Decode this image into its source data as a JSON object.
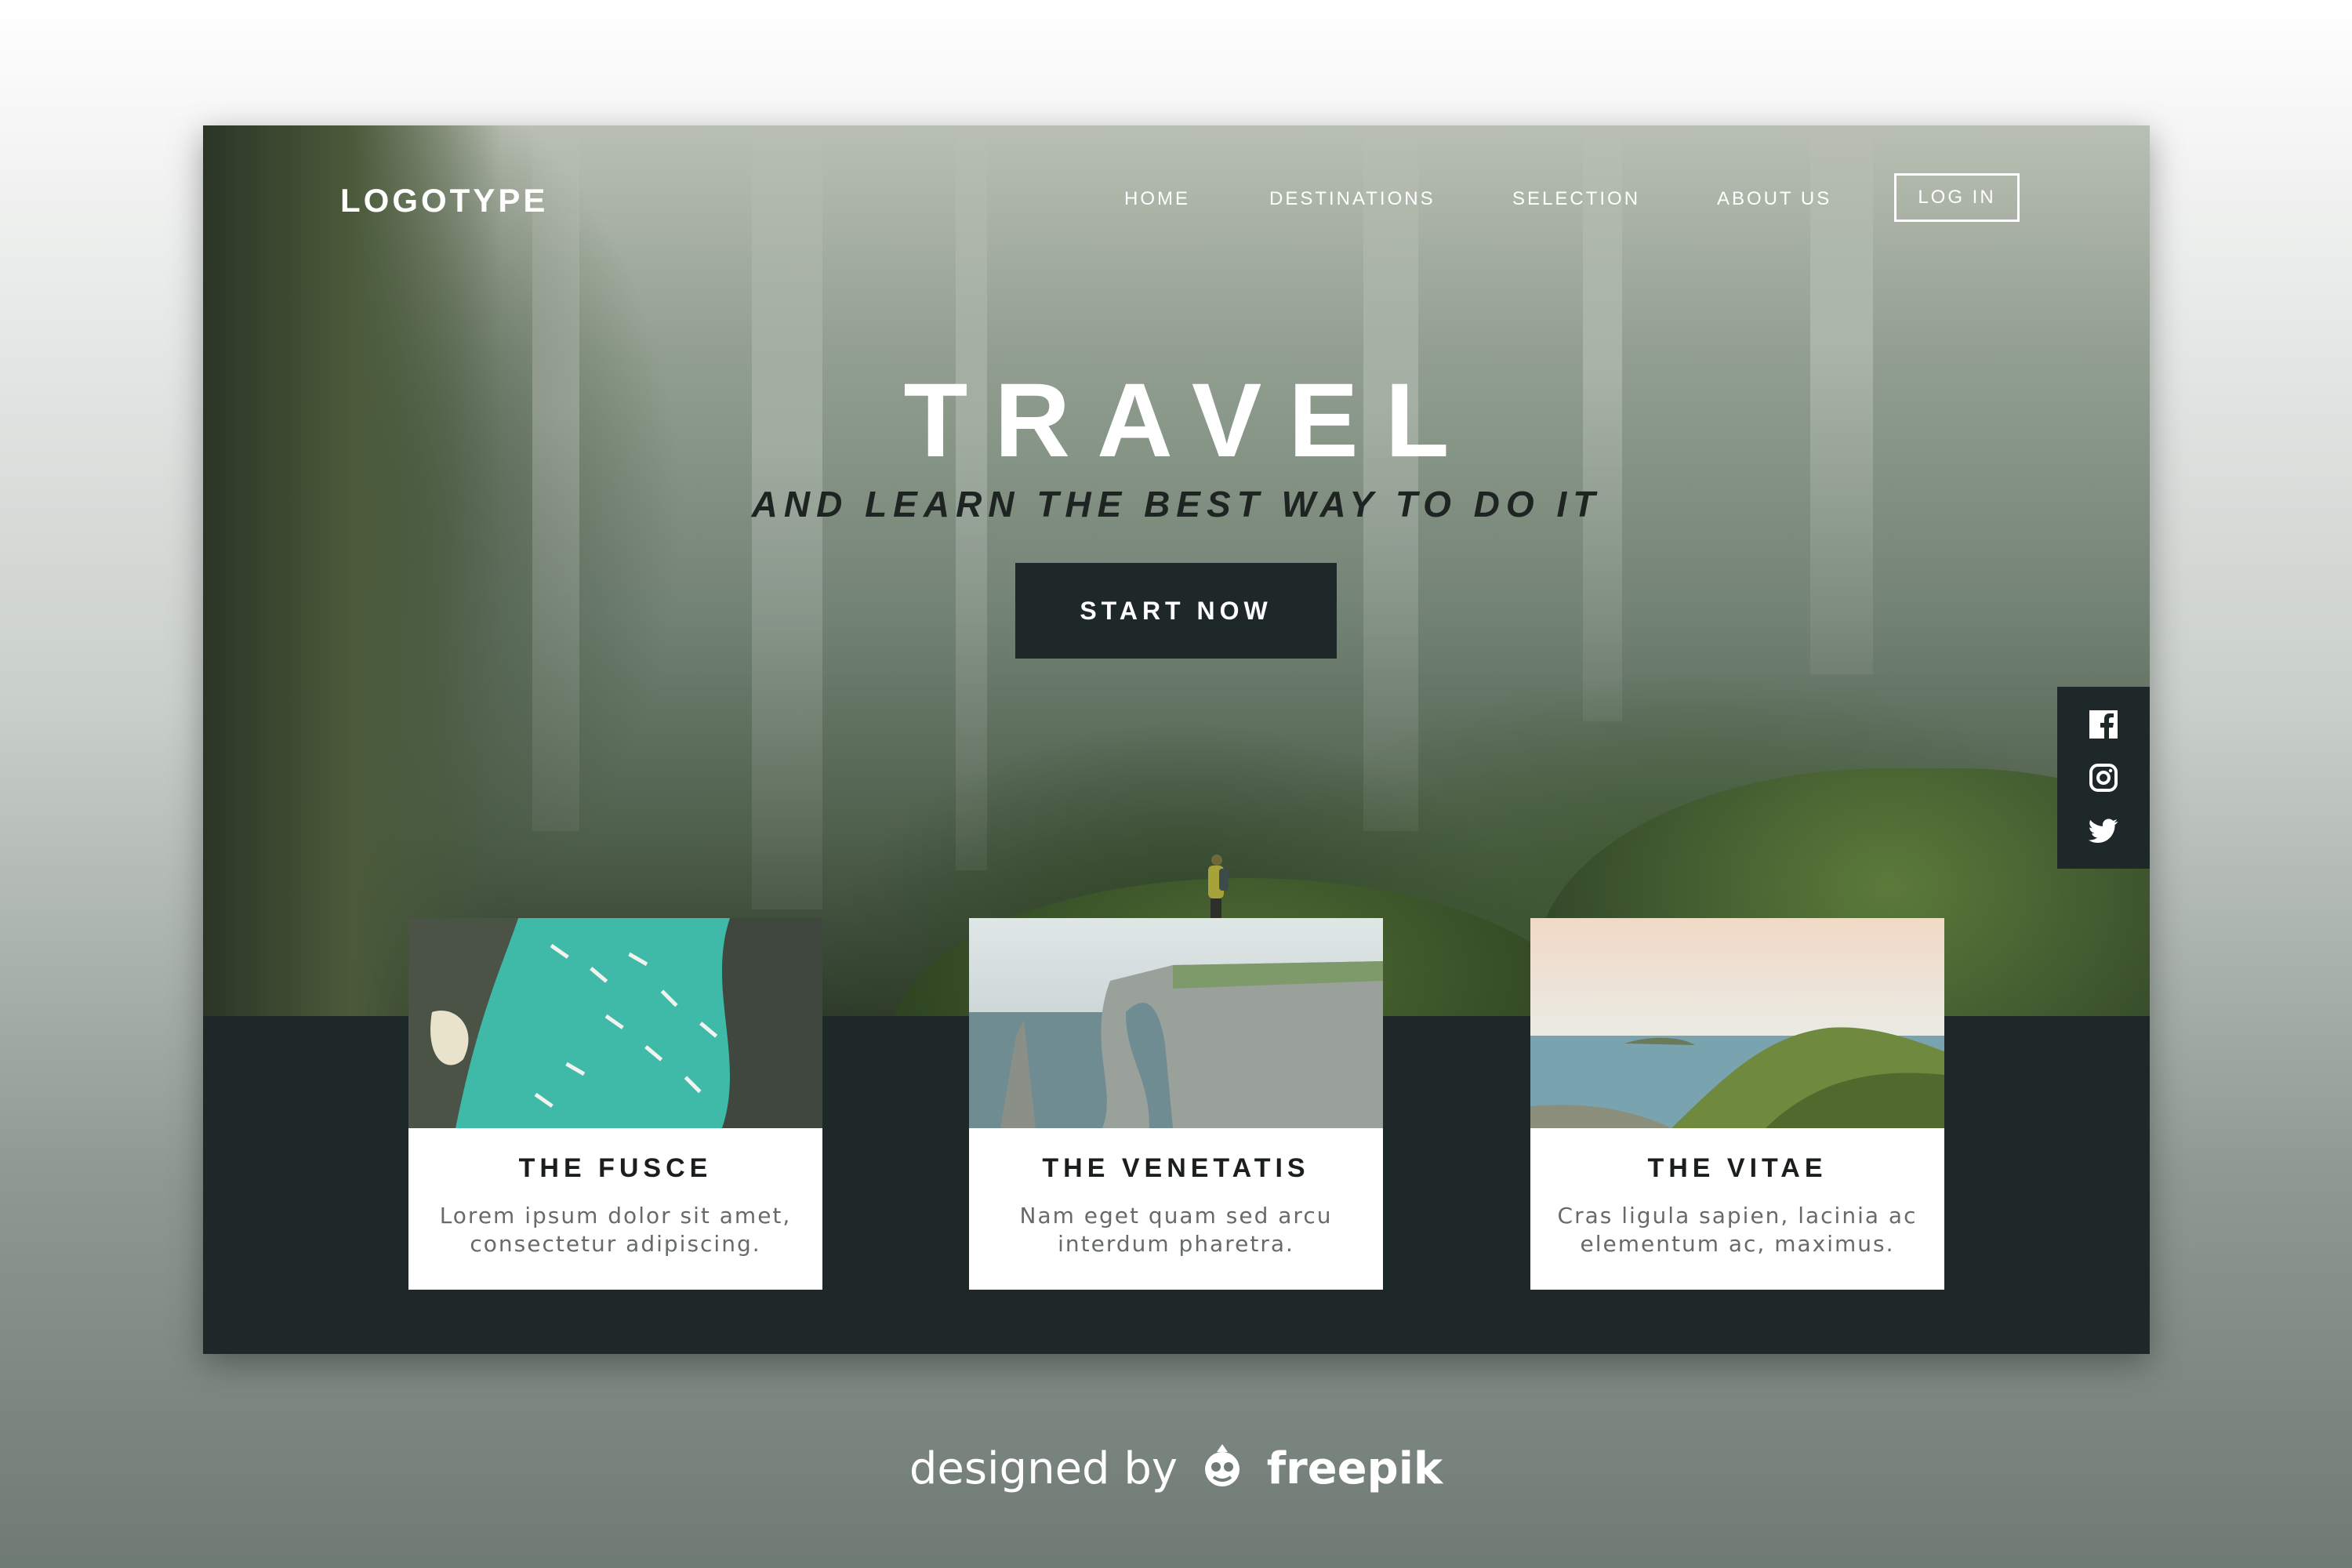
{
  "header": {
    "logo": "LOGOTYPE",
    "nav": [
      {
        "label": "HOME"
      },
      {
        "label": "DESTINATIONS"
      },
      {
        "label": "SELECTION"
      },
      {
        "label": "ABOUT US"
      }
    ],
    "login_label": "LOG IN"
  },
  "hero": {
    "title": "TRAVEL",
    "subtitle": "AND LEARN THE BEST WAY TO DO IT",
    "cta_label": "START NOW"
  },
  "social": {
    "icons": [
      "facebook-icon",
      "instagram-icon",
      "twitter-icon"
    ]
  },
  "cards": [
    {
      "title": "THE FUSCE",
      "desc_line1": "Lorem ipsum dolor sit amet,",
      "desc_line2": "consectetur adipiscing."
    },
    {
      "title": "THE VENETATIS",
      "desc_line1": "Nam eget quam sed arcu",
      "desc_line2": "interdum pharetra."
    },
    {
      "title": "THE VITAE",
      "desc_line1": "Cras ligula sapien, lacinia ac",
      "desc_line2": "elementum ac, maximus."
    }
  ],
  "footer": {
    "credit_prefix": "designed by",
    "credit_brand": "freepik"
  },
  "colors": {
    "dark": "#1f2828",
    "white": "#ffffff",
    "text_gray": "#666b69"
  }
}
